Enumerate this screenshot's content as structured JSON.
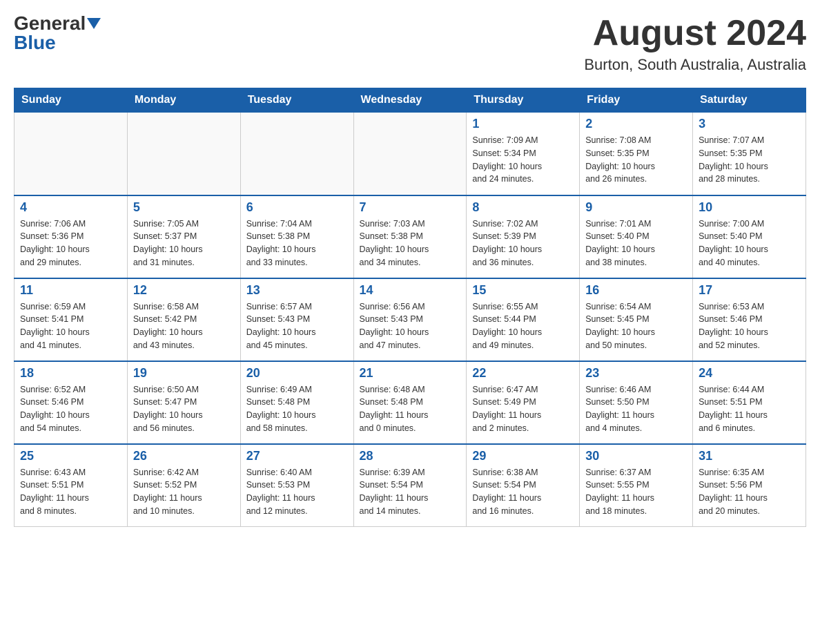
{
  "header": {
    "logo_general": "General",
    "logo_blue": "Blue",
    "month_title": "August 2024",
    "location": "Burton, South Australia, Australia"
  },
  "weekdays": [
    "Sunday",
    "Monday",
    "Tuesday",
    "Wednesday",
    "Thursday",
    "Friday",
    "Saturday"
  ],
  "weeks": [
    [
      {
        "day": "",
        "info": ""
      },
      {
        "day": "",
        "info": ""
      },
      {
        "day": "",
        "info": ""
      },
      {
        "day": "",
        "info": ""
      },
      {
        "day": "1",
        "info": "Sunrise: 7:09 AM\nSunset: 5:34 PM\nDaylight: 10 hours\nand 24 minutes."
      },
      {
        "day": "2",
        "info": "Sunrise: 7:08 AM\nSunset: 5:35 PM\nDaylight: 10 hours\nand 26 minutes."
      },
      {
        "day": "3",
        "info": "Sunrise: 7:07 AM\nSunset: 5:35 PM\nDaylight: 10 hours\nand 28 minutes."
      }
    ],
    [
      {
        "day": "4",
        "info": "Sunrise: 7:06 AM\nSunset: 5:36 PM\nDaylight: 10 hours\nand 29 minutes."
      },
      {
        "day": "5",
        "info": "Sunrise: 7:05 AM\nSunset: 5:37 PM\nDaylight: 10 hours\nand 31 minutes."
      },
      {
        "day": "6",
        "info": "Sunrise: 7:04 AM\nSunset: 5:38 PM\nDaylight: 10 hours\nand 33 minutes."
      },
      {
        "day": "7",
        "info": "Sunrise: 7:03 AM\nSunset: 5:38 PM\nDaylight: 10 hours\nand 34 minutes."
      },
      {
        "day": "8",
        "info": "Sunrise: 7:02 AM\nSunset: 5:39 PM\nDaylight: 10 hours\nand 36 minutes."
      },
      {
        "day": "9",
        "info": "Sunrise: 7:01 AM\nSunset: 5:40 PM\nDaylight: 10 hours\nand 38 minutes."
      },
      {
        "day": "10",
        "info": "Sunrise: 7:00 AM\nSunset: 5:40 PM\nDaylight: 10 hours\nand 40 minutes."
      }
    ],
    [
      {
        "day": "11",
        "info": "Sunrise: 6:59 AM\nSunset: 5:41 PM\nDaylight: 10 hours\nand 41 minutes."
      },
      {
        "day": "12",
        "info": "Sunrise: 6:58 AM\nSunset: 5:42 PM\nDaylight: 10 hours\nand 43 minutes."
      },
      {
        "day": "13",
        "info": "Sunrise: 6:57 AM\nSunset: 5:43 PM\nDaylight: 10 hours\nand 45 minutes."
      },
      {
        "day": "14",
        "info": "Sunrise: 6:56 AM\nSunset: 5:43 PM\nDaylight: 10 hours\nand 47 minutes."
      },
      {
        "day": "15",
        "info": "Sunrise: 6:55 AM\nSunset: 5:44 PM\nDaylight: 10 hours\nand 49 minutes."
      },
      {
        "day": "16",
        "info": "Sunrise: 6:54 AM\nSunset: 5:45 PM\nDaylight: 10 hours\nand 50 minutes."
      },
      {
        "day": "17",
        "info": "Sunrise: 6:53 AM\nSunset: 5:46 PM\nDaylight: 10 hours\nand 52 minutes."
      }
    ],
    [
      {
        "day": "18",
        "info": "Sunrise: 6:52 AM\nSunset: 5:46 PM\nDaylight: 10 hours\nand 54 minutes."
      },
      {
        "day": "19",
        "info": "Sunrise: 6:50 AM\nSunset: 5:47 PM\nDaylight: 10 hours\nand 56 minutes."
      },
      {
        "day": "20",
        "info": "Sunrise: 6:49 AM\nSunset: 5:48 PM\nDaylight: 10 hours\nand 58 minutes."
      },
      {
        "day": "21",
        "info": "Sunrise: 6:48 AM\nSunset: 5:48 PM\nDaylight: 11 hours\nand 0 minutes."
      },
      {
        "day": "22",
        "info": "Sunrise: 6:47 AM\nSunset: 5:49 PM\nDaylight: 11 hours\nand 2 minutes."
      },
      {
        "day": "23",
        "info": "Sunrise: 6:46 AM\nSunset: 5:50 PM\nDaylight: 11 hours\nand 4 minutes."
      },
      {
        "day": "24",
        "info": "Sunrise: 6:44 AM\nSunset: 5:51 PM\nDaylight: 11 hours\nand 6 minutes."
      }
    ],
    [
      {
        "day": "25",
        "info": "Sunrise: 6:43 AM\nSunset: 5:51 PM\nDaylight: 11 hours\nand 8 minutes."
      },
      {
        "day": "26",
        "info": "Sunrise: 6:42 AM\nSunset: 5:52 PM\nDaylight: 11 hours\nand 10 minutes."
      },
      {
        "day": "27",
        "info": "Sunrise: 6:40 AM\nSunset: 5:53 PM\nDaylight: 11 hours\nand 12 minutes."
      },
      {
        "day": "28",
        "info": "Sunrise: 6:39 AM\nSunset: 5:54 PM\nDaylight: 11 hours\nand 14 minutes."
      },
      {
        "day": "29",
        "info": "Sunrise: 6:38 AM\nSunset: 5:54 PM\nDaylight: 11 hours\nand 16 minutes."
      },
      {
        "day": "30",
        "info": "Sunrise: 6:37 AM\nSunset: 5:55 PM\nDaylight: 11 hours\nand 18 minutes."
      },
      {
        "day": "31",
        "info": "Sunrise: 6:35 AM\nSunset: 5:56 PM\nDaylight: 11 hours\nand 20 minutes."
      }
    ]
  ]
}
